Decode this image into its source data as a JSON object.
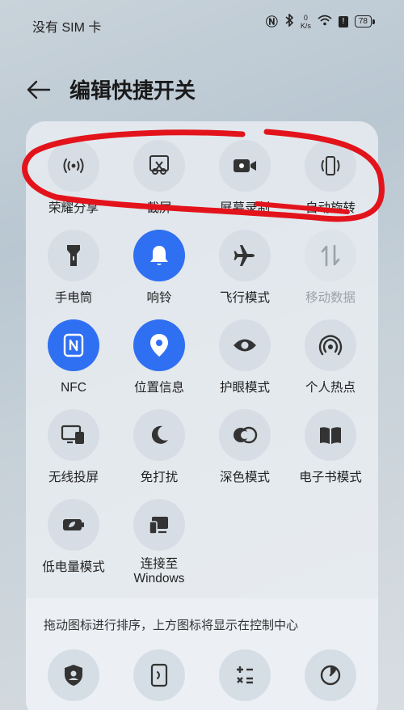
{
  "status": {
    "carrier": "没有 SIM 卡",
    "speed_value": "0",
    "speed_unit": "K/s",
    "battery": "78"
  },
  "header": {
    "title": "编辑快捷开关"
  },
  "tiles": [
    {
      "label": "荣耀分享",
      "icon": "wireless-share-icon"
    },
    {
      "label": "截屏",
      "icon": "screenshot-icon"
    },
    {
      "label": "屏幕录制",
      "icon": "screen-record-icon"
    },
    {
      "label": "自动旋转",
      "icon": "auto-rotate-icon"
    },
    {
      "label": "手电筒",
      "icon": "flashlight-icon"
    },
    {
      "label": "响铃",
      "icon": "bell-icon",
      "active": true
    },
    {
      "label": "飞行模式",
      "icon": "airplane-icon"
    },
    {
      "label": "移动数据",
      "icon": "mobile-data-icon",
      "disabled": true
    },
    {
      "label": "NFC",
      "icon": "nfc-icon",
      "active": true
    },
    {
      "label": "位置信息",
      "icon": "location-icon",
      "active": true
    },
    {
      "label": "护眼模式",
      "icon": "eye-icon"
    },
    {
      "label": "个人热点",
      "icon": "hotspot-icon"
    },
    {
      "label": "无线投屏",
      "icon": "wireless-projection-icon"
    },
    {
      "label": "免打扰",
      "icon": "moon-icon"
    },
    {
      "label": "深色模式",
      "icon": "dark-mode-icon"
    },
    {
      "label": "电子书模式",
      "icon": "book-icon"
    },
    {
      "label": "低电量模式",
      "icon": "low-battery-icon"
    },
    {
      "label_line1": "连接至",
      "label_line2": "Windows",
      "icon": "connect-windows-icon"
    }
  ],
  "hint": "拖动图标进行排序，上方图标将显示在控制中心",
  "extra_tiles": [
    {
      "icon": "shield-icon"
    },
    {
      "icon": "nfc-card-icon"
    },
    {
      "icon": "calculator-icon"
    },
    {
      "icon": "timer-icon"
    }
  ],
  "colors": {
    "accent": "#2f6ff2",
    "annotation": "#e3131b"
  }
}
